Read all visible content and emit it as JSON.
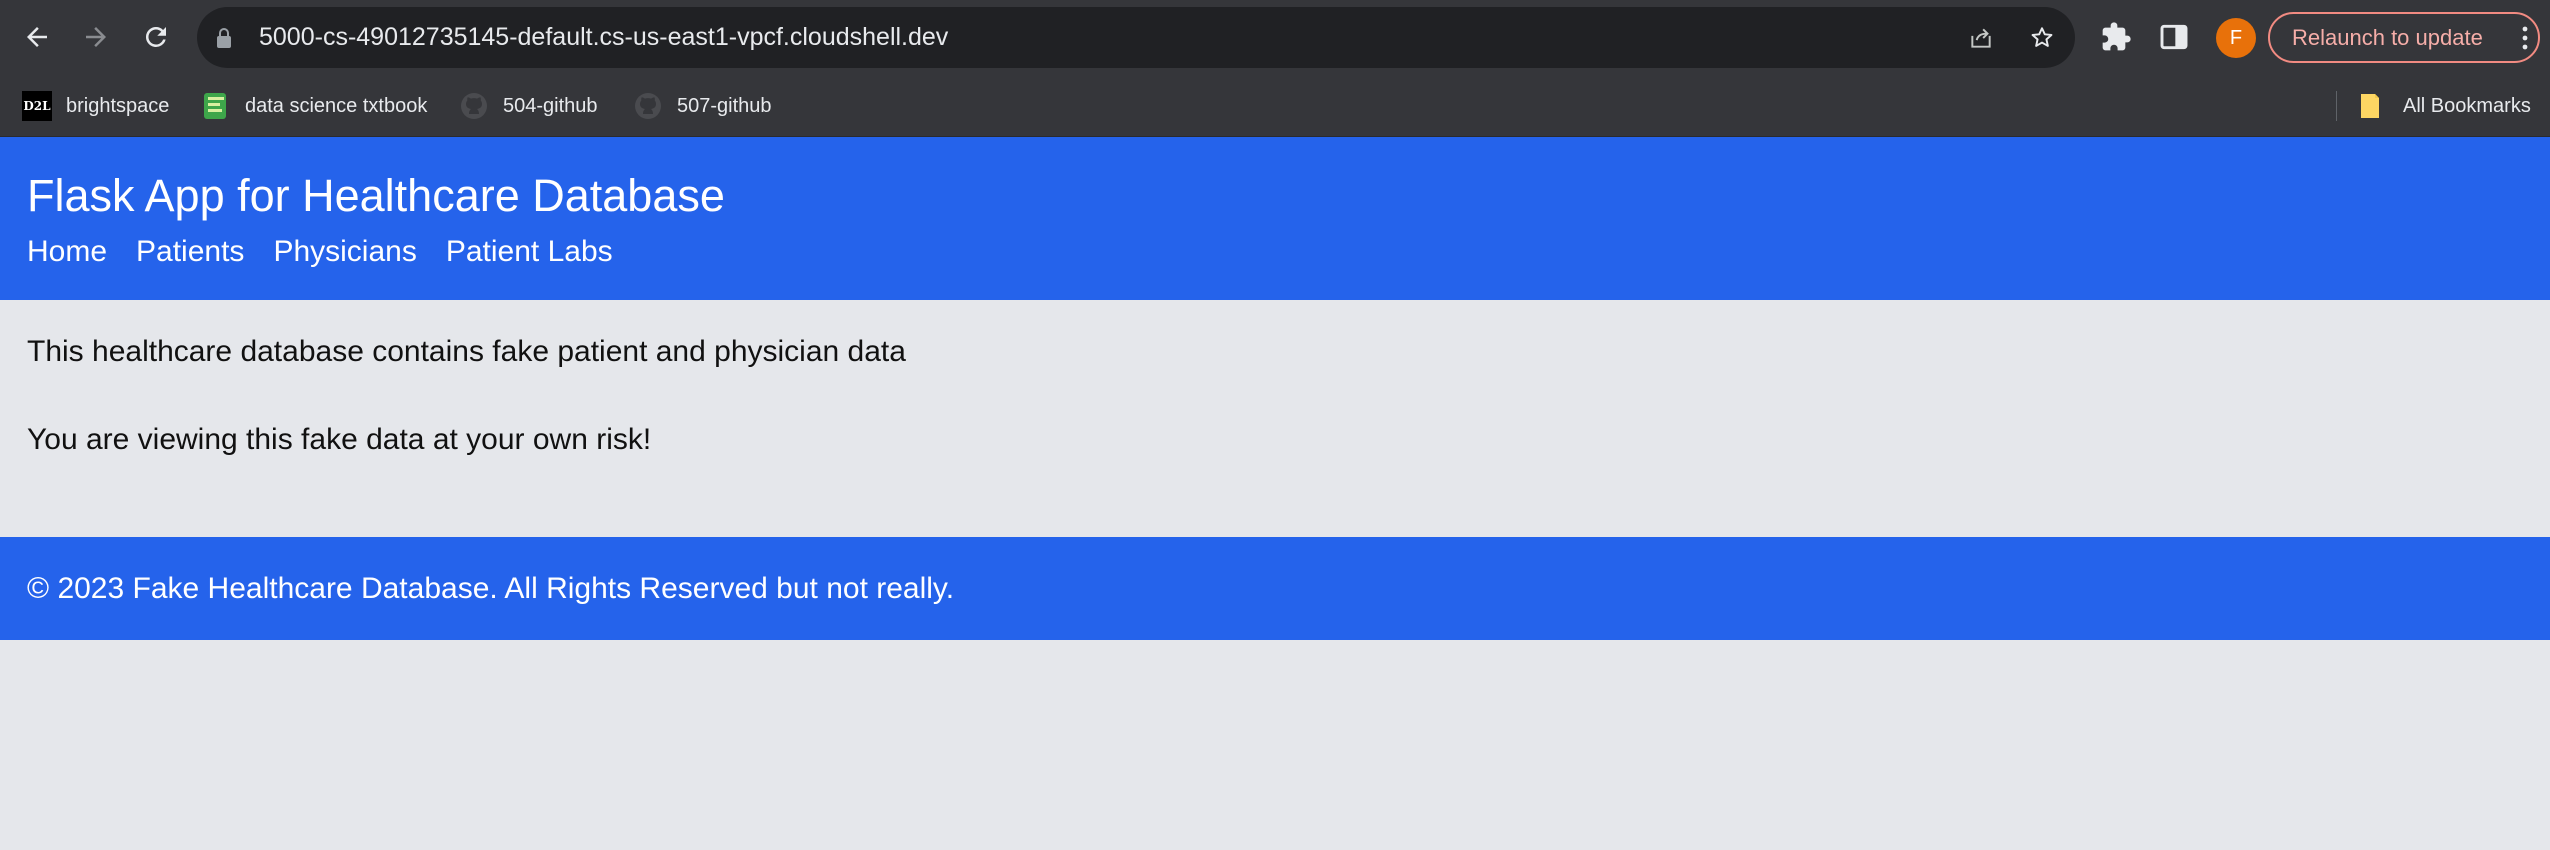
{
  "browser": {
    "url": "5000-cs-49012735145-default.cs-us-east1-vpcf.cloudshell.dev",
    "profile_initial": "F",
    "relaunch_label": "Relaunch to update",
    "bookmarks": [
      {
        "label": "brightspace",
        "icon": "d2l-logo-icon"
      },
      {
        "label": "data science txtbook",
        "icon": "book-icon"
      },
      {
        "label": "504-github",
        "icon": "github-icon"
      },
      {
        "label": "507-github",
        "icon": "github-icon"
      }
    ],
    "all_bookmarks_label": "All Bookmarks",
    "colors": {
      "chrome": "#35363a",
      "omnibox": "#202124",
      "avatar": "#e8710a",
      "relaunch_border": "#f28b82"
    }
  },
  "page": {
    "title": "Flask App for Healthcare Database",
    "nav": [
      "Home",
      "Patients",
      "Physicians",
      "Patient Labs"
    ],
    "content": [
      "This healthcare database contains fake patient and physician data",
      "You are viewing this fake data at your own risk!"
    ],
    "footer": "© 2023 Fake Healthcare Database. All Rights Reserved but not really.",
    "colors": {
      "brand": "#2563eb",
      "background": "#e5e7eb"
    }
  }
}
